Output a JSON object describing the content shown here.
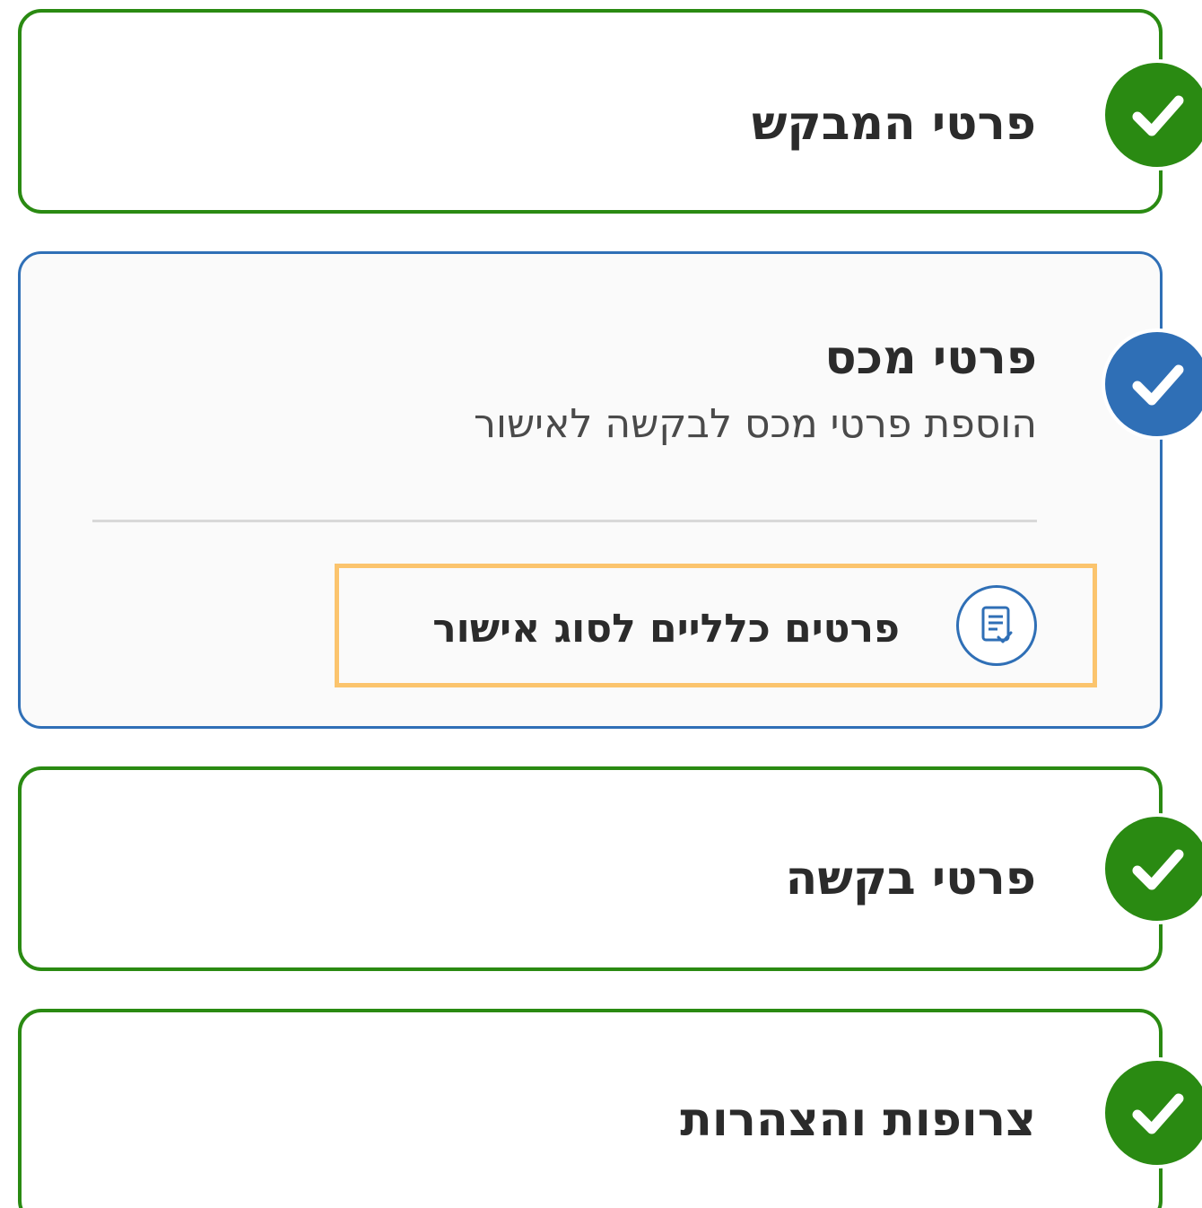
{
  "colors": {
    "completed": "#2a8a12",
    "active": "#2f6fb6",
    "focus_outline": "#fbc46d",
    "text": "#2b2b2b"
  },
  "steps": [
    {
      "title": "פרטי המבקש",
      "status": "completed",
      "icon": "check-icon"
    },
    {
      "title": "פרטי מכס",
      "subtitle": "הוספת פרטי מכס לבקשה לאישור",
      "status": "active",
      "icon": "check-icon",
      "substeps": [
        {
          "label": "פרטים כלליים לסוג אישור",
          "icon": "document-check-icon"
        }
      ]
    },
    {
      "title": "פרטי בקשה",
      "status": "completed",
      "icon": "check-icon"
    },
    {
      "title": "צרופות והצהרות",
      "status": "completed",
      "icon": "check-icon"
    }
  ]
}
